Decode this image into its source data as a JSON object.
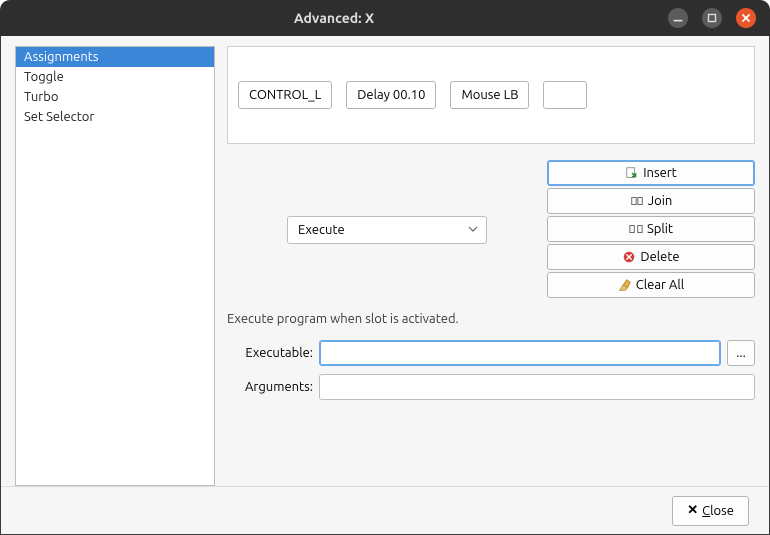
{
  "colors": {
    "titlebar_bg": "#2e2e2e",
    "close_btn": "#e9562a",
    "selection": "#3b86d6"
  },
  "window": {
    "title": "Advanced: X"
  },
  "sidebar": {
    "items": [
      {
        "label": "Assignments",
        "selected": true
      },
      {
        "label": "Toggle",
        "selected": false
      },
      {
        "label": "Turbo",
        "selected": false
      },
      {
        "label": "Set Selector",
        "selected": false
      }
    ]
  },
  "slots": [
    {
      "label": "CONTROL_L"
    },
    {
      "label": "Delay 00.10"
    },
    {
      "label": "Mouse LB"
    },
    {
      "label": ""
    }
  ],
  "type_select": {
    "value": "Execute"
  },
  "action_buttons": {
    "insert": "Insert",
    "join": "Join",
    "split": "Split",
    "delete": "Delete",
    "clear_all": "Clear All"
  },
  "help_text": "Execute program when slot is activated.",
  "form": {
    "executable_label": "Executable:",
    "executable_value": "",
    "arguments_label": "Arguments:",
    "arguments_value": "",
    "browse_label": "..."
  },
  "footer": {
    "close": "Close"
  }
}
